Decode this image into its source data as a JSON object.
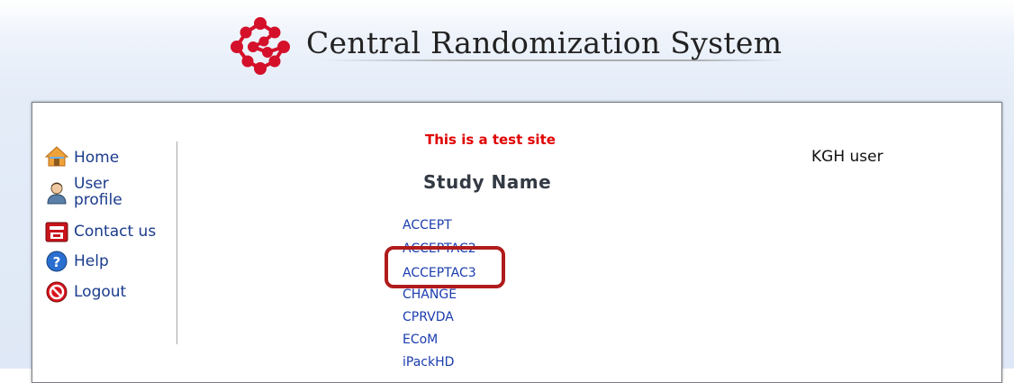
{
  "header": {
    "title": "Central Randomization System",
    "logo_icon": "red-network-logo"
  },
  "sidebar": {
    "items": [
      {
        "label": "Home",
        "icon": "home-icon"
      },
      {
        "label": "User\nprofile",
        "icon": "user-icon"
      },
      {
        "label": "Contact us",
        "icon": "phone-icon"
      },
      {
        "label": "Help",
        "icon": "help-icon"
      },
      {
        "label": "Logout",
        "icon": "logout-icon"
      }
    ]
  },
  "main": {
    "notice": "This is a test site",
    "heading": "Study Name",
    "user": "KGH user",
    "studies": [
      "ACCEPT",
      "ACCEPTAC2",
      "ACCEPTAC3",
      "CHANGE",
      "CPRVDA",
      "ECoM",
      "iPackHD"
    ],
    "highlighted_study": "ACCEPTAC3"
  },
  "colors": {
    "link": "#1a3cae",
    "notice": "#e00000",
    "highlight_border": "#b01c1c",
    "logo": "#d4102a"
  }
}
